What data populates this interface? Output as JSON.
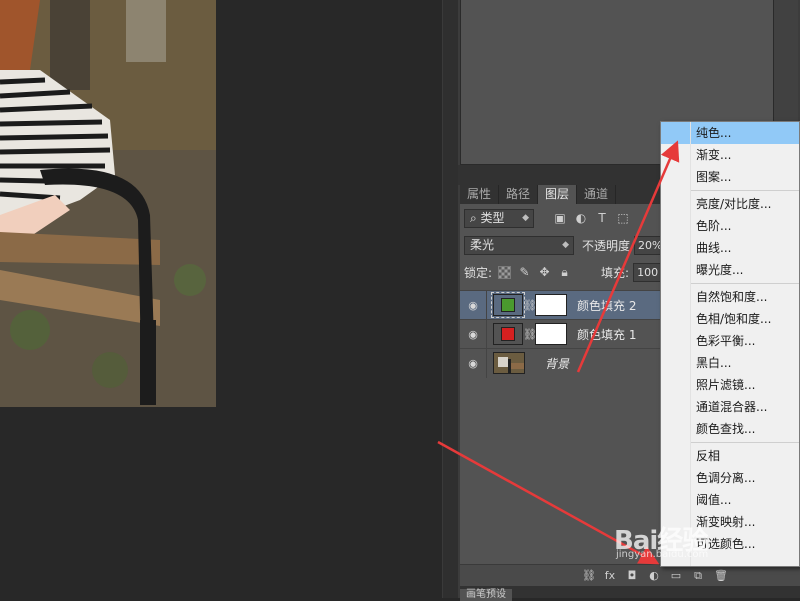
{
  "panel": {
    "tabs": [
      {
        "label": "属性",
        "active": false
      },
      {
        "label": "路径",
        "active": false
      },
      {
        "label": "图层",
        "active": true
      },
      {
        "label": "通道",
        "active": false
      }
    ],
    "filter": {
      "search_icon": "search-icon",
      "type_label": "类型"
    },
    "blend": {
      "mode": "柔光",
      "opacity_label": "不透明度",
      "opacity_value": "20%"
    },
    "lock": {
      "label": "锁定:",
      "fill_label": "填充:",
      "fill_value": "100"
    },
    "layers": [
      {
        "name": "颜色填充 2",
        "swatch": "#4a9a2e",
        "selected": true
      },
      {
        "name": "颜色填充 1",
        "swatch": "#d62020",
        "selected": false
      },
      {
        "name": "背景",
        "swatch": null,
        "selected": false
      }
    ],
    "bottom_tab": "画笔预设"
  },
  "menu": {
    "groups": [
      [
        "纯色...",
        "渐变...",
        "图案..."
      ],
      [
        "亮度/对比度...",
        "色阶...",
        "曲线...",
        "曝光度..."
      ],
      [
        "自然饱和度...",
        "色相/饱和度...",
        "色彩平衡...",
        "黑白...",
        "照片滤镜...",
        "通道混合器...",
        "颜色查找..."
      ],
      [
        "反相",
        "色调分离...",
        "阈值...",
        "渐变映射...",
        "可选颜色..."
      ]
    ],
    "highlighted": "纯色..."
  },
  "colors": {
    "accent_highlight": "#91c9f7",
    "selected_layer": "#5a6a80",
    "arrow": "#e63a3a"
  },
  "watermark": {
    "brand": "Bai经验",
    "url": "jingyan.baidu.com"
  }
}
